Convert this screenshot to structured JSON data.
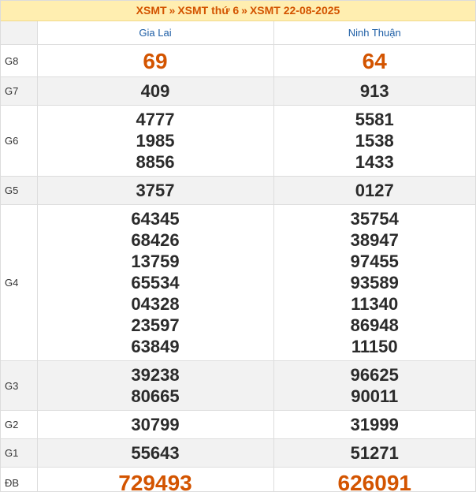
{
  "breadcrumb": {
    "items": [
      "XSMT",
      "XSMT thứ 6",
      "XSMT 22-08-2025"
    ],
    "separator": "»"
  },
  "colors": {
    "accent": "#d35400",
    "province": "#1f5fa6",
    "header_bg": "#ffeeb0"
  },
  "provinces": [
    "Gia Lai",
    "Ninh Thuận"
  ],
  "prizes": [
    {
      "label": "G8",
      "values": [
        [
          "69"
        ],
        [
          "64"
        ]
      ],
      "style": "big"
    },
    {
      "label": "G7",
      "values": [
        [
          "409"
        ],
        [
          "913"
        ]
      ]
    },
    {
      "label": "G6",
      "values": [
        [
          "4777",
          "1985",
          "8856"
        ],
        [
          "5581",
          "1538",
          "1433"
        ]
      ]
    },
    {
      "label": "G5",
      "values": [
        [
          "3757"
        ],
        [
          "0127"
        ]
      ]
    },
    {
      "label": "G4",
      "values": [
        [
          "64345",
          "68426",
          "13759",
          "65534",
          "04328",
          "23597",
          "63849"
        ],
        [
          "35754",
          "38947",
          "97455",
          "93589",
          "11340",
          "86948",
          "11150"
        ]
      ]
    },
    {
      "label": "G3",
      "values": [
        [
          "39238",
          "80665"
        ],
        [
          "96625",
          "90011"
        ]
      ]
    },
    {
      "label": "G2",
      "values": [
        [
          "30799"
        ],
        [
          "31999"
        ]
      ]
    },
    {
      "label": "G1",
      "values": [
        [
          "55643"
        ],
        [
          "51271"
        ]
      ]
    },
    {
      "label": "ĐB",
      "values": [
        [
          "729493"
        ],
        [
          "626091"
        ]
      ],
      "style": "huge"
    }
  ]
}
